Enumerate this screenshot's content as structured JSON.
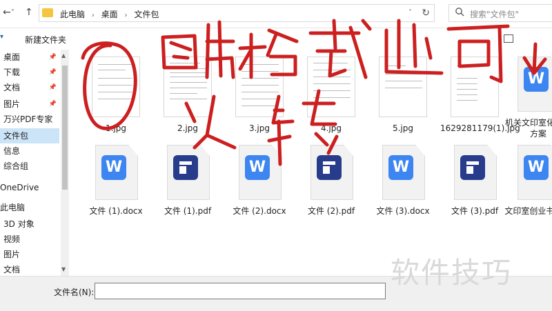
{
  "nav": {
    "back": "←",
    "forward": "→",
    "up_arrow": "˅",
    "up": "↑"
  },
  "address": {
    "crumbs": [
      "此电脑",
      "桌面",
      "文件包"
    ],
    "separator": "›",
    "refresh_icon": "↻",
    "dropdown_icon": "˅"
  },
  "search": {
    "placeholder": "搜索\"文件包\"",
    "icon": "search-icon"
  },
  "toolbar": {
    "new_folder": "新建文件夹",
    "expand": "▾"
  },
  "sidebar": {
    "items": [
      "桌面",
      "下载",
      "文档",
      "图片",
      "万兴PDF专家",
      "文件包",
      "信息",
      "综合组",
      "OneDrive",
      "此电脑",
      "3D 对象",
      "视频",
      "图片",
      "文档"
    ],
    "pin_icon": "📌",
    "selected_index": 5
  },
  "files_row1": [
    {
      "name": "1.jpg",
      "kind": "jpg"
    },
    {
      "name": "2.jpg",
      "kind": "jpg"
    },
    {
      "name": "3.jpg",
      "kind": "jpg"
    },
    {
      "name": "4.jpg",
      "kind": "jpg"
    },
    {
      "name": "5.jpg",
      "kind": "jpg"
    },
    {
      "name": "1629281179(1).jpg",
      "kind": "jpg"
    },
    {
      "name": "机关文印室化运营方案",
      "kind": "docx"
    }
  ],
  "files_row2": [
    {
      "name": "文件 (1).docx",
      "kind": "docx"
    },
    {
      "name": "文件 (1).pdf",
      "kind": "pdf"
    },
    {
      "name": "文件 (2).docx",
      "kind": "docx"
    },
    {
      "name": "文件 (2).pdf",
      "kind": "pdf"
    },
    {
      "name": "文件 (3).docx",
      "kind": "docx"
    },
    {
      "name": "文件 (3).pdf",
      "kind": "pdf"
    },
    {
      "name": "文印室创业书.doc",
      "kind": "docx"
    }
  ],
  "bottom": {
    "filename_label": "文件名(N):"
  },
  "watermark": "软件技巧",
  "colors": {
    "annotation_red": "#cc1f1f",
    "selected": "#cce4f7",
    "word_blue": "#3d85f0",
    "pdf_navy": "#283c8c"
  }
}
